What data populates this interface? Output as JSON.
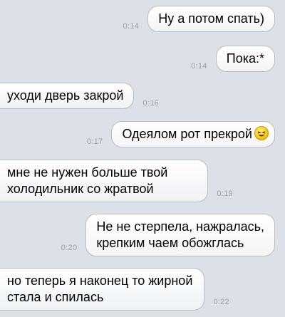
{
  "messages": [
    {
      "direction": "out",
      "time": "0:14",
      "text": "Ну а потом спать)"
    },
    {
      "direction": "out",
      "time": "0:14",
      "text": "Пока:*"
    },
    {
      "direction": "in",
      "time": "0:16",
      "text": "уходи дверь закрой"
    },
    {
      "direction": "out",
      "time": "0:17",
      "text": "Одеялом рот прекрой",
      "emoji": "laughing-face-icon"
    },
    {
      "direction": "in",
      "time": "0:19",
      "lines": [
        "мне не нужен больше твой",
        "холодильник со жратвой"
      ]
    },
    {
      "direction": "out",
      "time": "0:20",
      "lines": [
        "Не не стерпела, нажралась,",
        "крепким чаем обожглась"
      ]
    },
    {
      "direction": "in",
      "time": "0:22",
      "lines": [
        "но теперь я наконец то жирной",
        "стала и спилась"
      ]
    }
  ],
  "colors": {
    "background": "#dde0e7",
    "bubble": "#ffffff",
    "bubble_border": "#b9bcc2",
    "timestamp": "#9aa0a8"
  }
}
